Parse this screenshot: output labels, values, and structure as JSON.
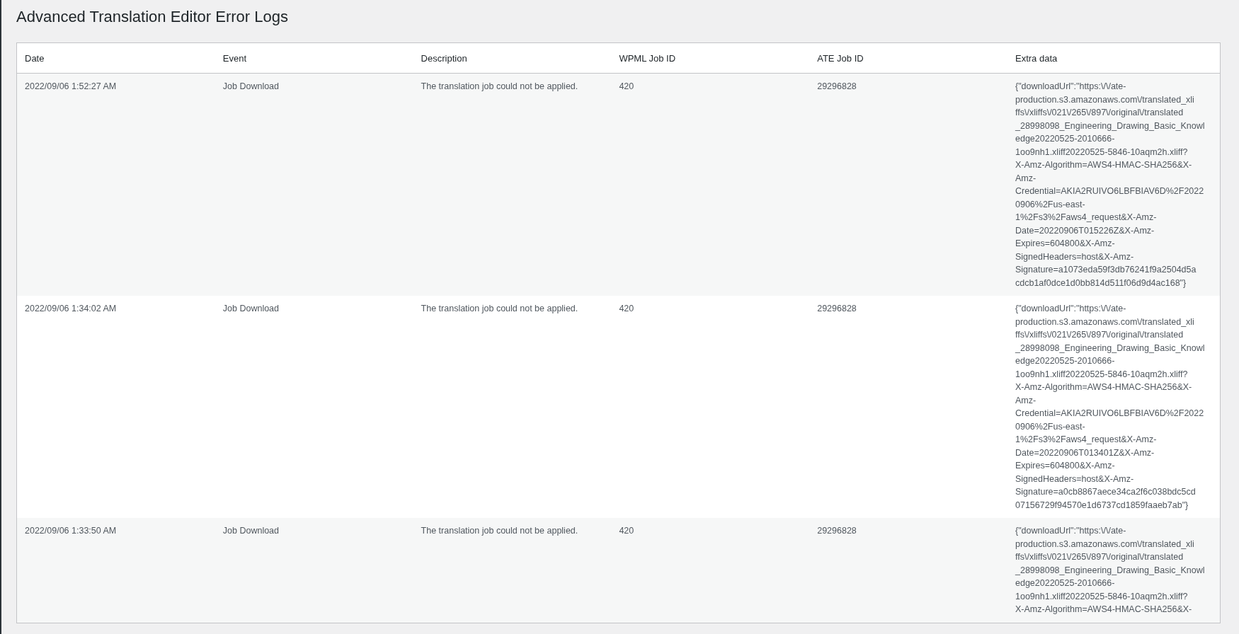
{
  "title": "Advanced Translation Editor Error Logs",
  "table": {
    "columns": [
      "Date",
      "Event",
      "Description",
      "WPML Job ID",
      "ATE Job ID",
      "Extra data"
    ],
    "rows": [
      {
        "date": "2022/09/06 1:52:27 AM",
        "event": "Job Download",
        "description": "The translation job could not be applied.",
        "wpml_job_id": "420",
        "ate_job_id": "29296828",
        "extra_data_lines": [
          "{\"downloadUrl\":\"https:\\/\\/ate-",
          "production.s3.amazonaws.com\\/translated_xli",
          "ffs\\/xliffs\\/021\\/265\\/897\\/original\\/translated",
          "_28998098_Engineering_Drawing_Basic_Knowl",
          "edge20220525-2010666-",
          "1oo9nh1.xliff20220525-5846-10aqm2h.xliff?",
          "X-Amz-Algorithm=AWS4-HMAC-SHA256&X-",
          "Amz-",
          "Credential=AKIA2RUIVO6LBFBIAV6D%2F2022",
          "0906%2Fus-east-",
          "1%2Fs3%2Faws4_request&X-Amz-",
          "Date=20220906T015226Z&X-Amz-",
          "Expires=604800&X-Amz-",
          "SignedHeaders=host&X-Amz-",
          "Signature=a1073eda59f3db76241f9a2504d5a",
          "cdcb1af0dce1d0bb814d511f06d9d4ac168\"}"
        ]
      },
      {
        "date": "2022/09/06 1:34:02 AM",
        "event": "Job Download",
        "description": "The translation job could not be applied.",
        "wpml_job_id": "420",
        "ate_job_id": "29296828",
        "extra_data_lines": [
          "{\"downloadUrl\":\"https:\\/\\/ate-",
          "production.s3.amazonaws.com\\/translated_xli",
          "ffs\\/xliffs\\/021\\/265\\/897\\/original\\/translated",
          "_28998098_Engineering_Drawing_Basic_Knowl",
          "edge20220525-2010666-",
          "1oo9nh1.xliff20220525-5846-10aqm2h.xliff?",
          "X-Amz-Algorithm=AWS4-HMAC-SHA256&X-",
          "Amz-",
          "Credential=AKIA2RUIVO6LBFBIAV6D%2F2022",
          "0906%2Fus-east-",
          "1%2Fs3%2Faws4_request&X-Amz-",
          "Date=20220906T013401Z&X-Amz-",
          "Expires=604800&X-Amz-",
          "SignedHeaders=host&X-Amz-",
          "Signature=a0cb8867aece34ca2f6c038bdc5cd",
          "07156729f94570e1d6737cd1859faaeb7ab\"}"
        ]
      },
      {
        "date": "2022/09/06 1:33:50 AM",
        "event": "Job Download",
        "description": "The translation job could not be applied.",
        "wpml_job_id": "420",
        "ate_job_id": "29296828",
        "extra_data_lines": [
          "{\"downloadUrl\":\"https:\\/\\/ate-",
          "production.s3.amazonaws.com\\/translated_xli",
          "ffs\\/xliffs\\/021\\/265\\/897\\/original\\/translated",
          "_28998098_Engineering_Drawing_Basic_Knowl",
          "edge20220525-2010666-",
          "1oo9nh1.xliff20220525-5846-10aqm2h.xliff?",
          "X-Amz-Algorithm=AWS4-HMAC-SHA256&X-"
        ]
      }
    ]
  }
}
